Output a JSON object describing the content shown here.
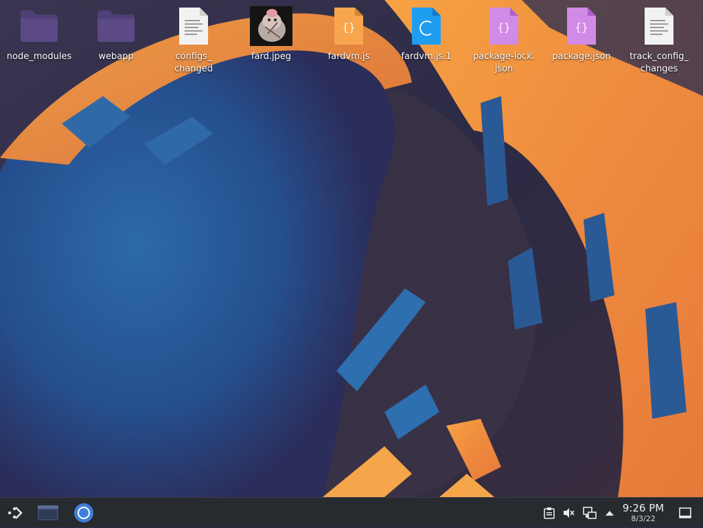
{
  "desktop": {
    "icons": [
      {
        "label": "node_modules",
        "icon": "folder-icon"
      },
      {
        "label": "webapp",
        "icon": "folder-icon"
      },
      {
        "label": "configs_\nchanged",
        "icon": "text-file-icon"
      },
      {
        "label": "fard.jpeg",
        "icon": "image-thumbnail-icon"
      },
      {
        "label": "fardvm.js",
        "icon": "javascript-file-icon"
      },
      {
        "label": "fardvm.js.1",
        "icon": "c-source-file-icon"
      },
      {
        "label": "package-lock.\njson",
        "icon": "json-file-icon"
      },
      {
        "label": "package.json",
        "icon": "json-file-icon"
      },
      {
        "label": "track_config_\nchanges",
        "icon": "text-file-icon"
      }
    ]
  },
  "taskbar": {
    "launcher_icon": "application-launcher-icon",
    "tasks": [
      {
        "name": "file-manager",
        "icon": "folder-window-icon"
      },
      {
        "name": "chromium",
        "icon": "chromium-icon"
      }
    ],
    "tray": [
      {
        "name": "clipboard",
        "icon": "clipboard-icon"
      },
      {
        "name": "volume-muted",
        "icon": "speaker-muted-icon"
      },
      {
        "name": "network",
        "icon": "network-wired-icon"
      },
      {
        "name": "expand",
        "icon": "chevron-up-icon"
      }
    ],
    "clock": {
      "time": "9:26 PM",
      "date": "8/3/22"
    },
    "show_desktop_icon": "show-desktop-icon"
  },
  "colors": {
    "wallpaper_dark": "#2b2d4d",
    "wallpaper_blue": "#2f6aa6",
    "wallpaper_orange": "#f08a3c",
    "taskbar": "#272a2f",
    "folder": "#5b4a86"
  }
}
